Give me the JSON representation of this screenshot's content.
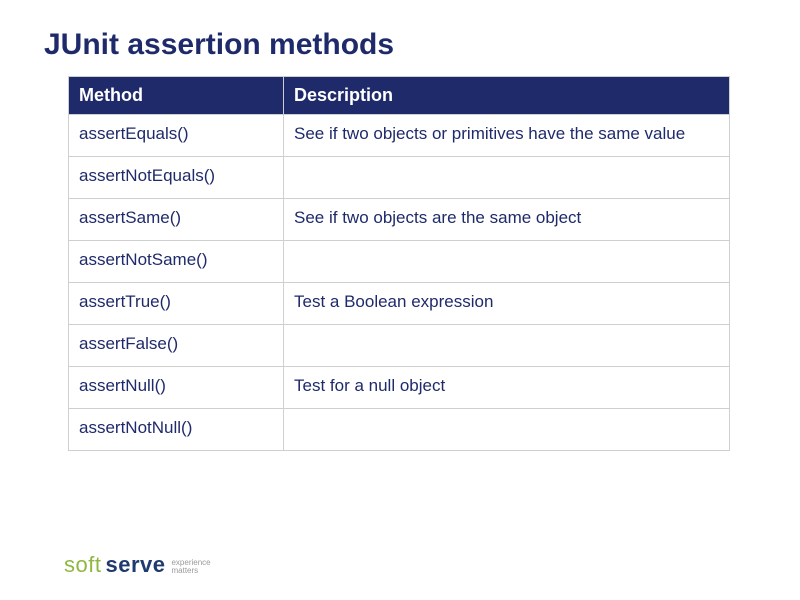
{
  "title": "JUnit assertion methods",
  "table": {
    "headers": {
      "method": "Method",
      "description": "Description"
    },
    "rows": [
      {
        "method": "assertEquals()",
        "description": "See if two objects or primitives have the same value"
      },
      {
        "method": "assertNotEquals()",
        "description": ""
      },
      {
        "method": "assertSame()",
        "description": "See if two objects are the same object"
      },
      {
        "method": "assertNotSame()",
        "description": ""
      },
      {
        "method": "assertTrue()",
        "description": "Test a Boolean expression"
      },
      {
        "method": "assertFalse()",
        "description": ""
      },
      {
        "method": "assertNull()",
        "description": "Test for a null object"
      },
      {
        "method": "assertNotNull()",
        "description": ""
      }
    ]
  },
  "logo": {
    "part1": "soft",
    "part2": "serve",
    "tagline1": "experience",
    "tagline2": "matters"
  }
}
